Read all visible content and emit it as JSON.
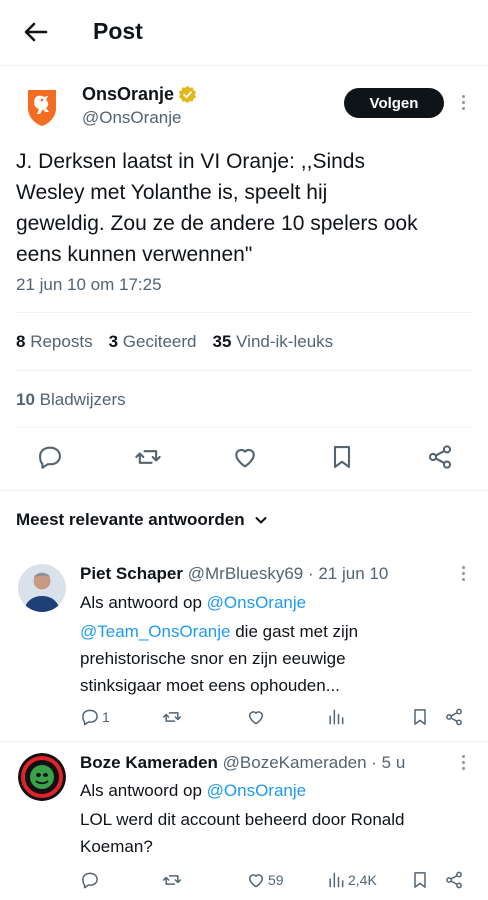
{
  "header": {
    "title": "Post"
  },
  "post": {
    "author_name": "OnsOranje",
    "author_handle": "@OnsOranje",
    "follow_label": "Volgen",
    "text_lines": [
      "J. Derksen laatst in VI Oranje: ,,Sinds",
      "Wesley met Yolanthe is, speelt hij",
      "geweldig. Zou ze de andere 10 spelers ook",
      "eens kunnen verwennen\""
    ],
    "timestamp": "21 jun 10 om 17:25",
    "reposts_count": "8",
    "reposts_label": "Reposts",
    "quotes_count": "3",
    "quotes_label": "Geciteerd",
    "likes_count": "35",
    "likes_label": "Vind-ik-leuks",
    "bookmarks_count": "10",
    "bookmarks_label": "Bladwijzers"
  },
  "sort": {
    "label": "Meest relevante antwoorden"
  },
  "replies": [
    {
      "name": "Piet Schaper",
      "handle_time": "@MrBluesky69 · 21 jun 10",
      "reply_prefix": "Als antwoord op",
      "reply_to": "@OnsOranje",
      "mention": "@Team_OnsOranje",
      "lines": [
        " die gast met zijn",
        "prehistorische snor en zijn eeuwige",
        "stinksigaar moet eens ophouden..."
      ],
      "reply_count": "1",
      "like_count": "",
      "view_count": ""
    },
    {
      "name": "Boze Kameraden",
      "handle_time": "@BozeKameraden · 5 u",
      "reply_prefix": "Als antwoord op",
      "reply_to": "@OnsOranje",
      "lines": [
        "LOL werd dit account beheerd door Ronald",
        "Koeman?"
      ],
      "reply_count": "",
      "like_count": "59",
      "view_count": "2,4K"
    }
  ],
  "colors": {
    "accent": "#1d9bf0",
    "brand_orange": "#f36c21",
    "verified_gold": "#e2b719",
    "text": "#0f1419",
    "muted": "#536471"
  },
  "icons": {
    "back": "arrow-left-icon",
    "verified": "verified-gold-badge-icon",
    "more": "more-vertical-icon",
    "reply": "reply-icon",
    "repost": "repost-icon",
    "like": "heart-icon",
    "bookmark": "bookmark-icon",
    "share": "share-icon",
    "views": "views-icon",
    "chevron": "chevron-down-icon"
  }
}
